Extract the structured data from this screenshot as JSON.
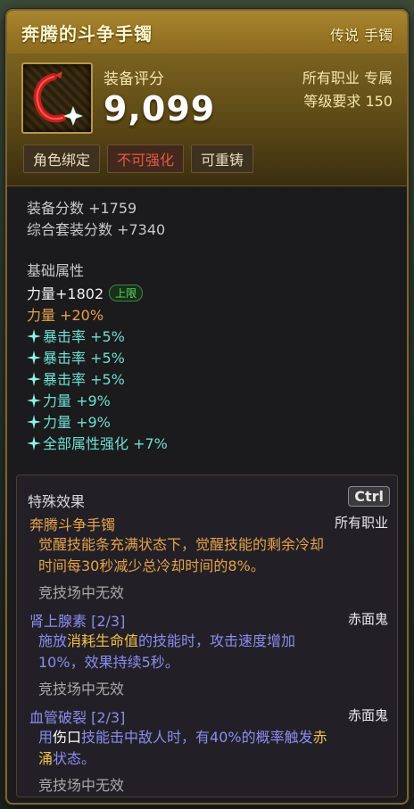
{
  "item": {
    "name": "奔腾的斗争手镯",
    "rarity": "传说",
    "type": "手镯",
    "score_label": "装备评分",
    "score": "9,099",
    "jobs": "所有职业 专属",
    "level_req": "等级要求 150",
    "tags": [
      {
        "label": "角色绑定"
      },
      {
        "label": "不可强化"
      },
      {
        "label": "可重铸"
      }
    ]
  },
  "scores": {
    "equip_points": "装备分数 +1759",
    "set_points": "综合套装分数 +7340"
  },
  "base": {
    "header": "基础属性",
    "strength": "力量+1802",
    "cap_badge": "上限",
    "percent_strength": "力量 +20%",
    "bonus_stats": [
      {
        "label": "暴击率 +5%"
      },
      {
        "label": "暴击率 +5%"
      },
      {
        "label": "暴击率 +5%"
      },
      {
        "label": "力量 +9%"
      },
      {
        "label": "力量 +9%"
      },
      {
        "label": "全部属性强化 +7%"
      }
    ]
  },
  "special": {
    "title": "特殊效果",
    "ctrl_key": "Ctrl",
    "effects": [
      {
        "name": "奔腾斗争手镯",
        "class": "所有职业",
        "desc_line1": "觉醒技能条充满状态下，觉醒技能的剩余冷却",
        "desc_line2": "时间每30秒减少总冷却时间的8%。",
        "note": "竞技场中无效"
      },
      {
        "name": "肾上腺素 [2/3]",
        "class": "赤面鬼",
        "desc_p1": "施放",
        "desc_hl": "消耗生命值",
        "desc_p2": "的技能时，攻击速度增加",
        "desc_line2": "10%，效果持续5秒。",
        "note": "竞技场中无效"
      },
      {
        "name": "血管破裂 [2/3]",
        "class": "赤面鬼",
        "desc_p1": "用",
        "desc_hl": "伤口",
        "desc_p2": "技能击中敌人时，有40%的概率触发",
        "desc_hl2": "赤",
        "desc_line2_hl": "涌",
        "desc_line2_rest": "状态。",
        "note": "竞技场中无效"
      }
    ]
  }
}
